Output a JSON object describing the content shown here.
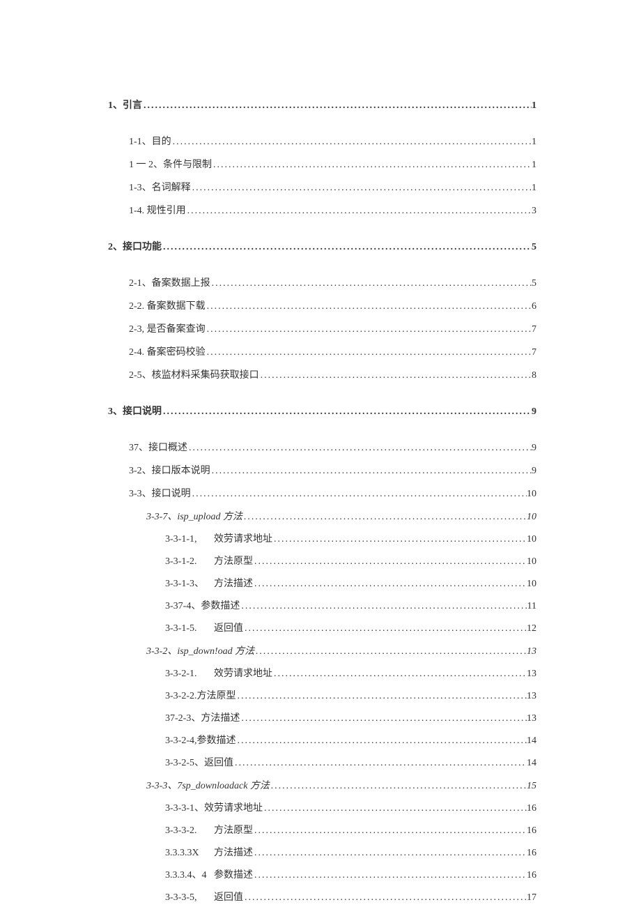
{
  "toc": [
    {
      "label": "1、引言",
      "page": "1",
      "indent": 0,
      "bold": true,
      "italic": false,
      "gap": "first",
      "split": false
    },
    {
      "label": "1-1、目的",
      "page": "1",
      "indent": 1,
      "bold": false,
      "italic": false,
      "gap": "top",
      "split": false
    },
    {
      "label": "1 一 2、条件与限制",
      "page": "1",
      "indent": 1,
      "bold": false,
      "italic": false,
      "gap": "line",
      "split": false
    },
    {
      "label": "1-3、名词解释",
      "page": "1",
      "indent": 1,
      "bold": false,
      "italic": false,
      "gap": "line",
      "split": false
    },
    {
      "label": "1-4. 规性引用",
      "page": "3",
      "indent": 1,
      "bold": false,
      "italic": false,
      "gap": "line",
      "split": false
    },
    {
      "label": "2、接口功能",
      "page": "5",
      "indent": 0,
      "bold": true,
      "italic": false,
      "gap": "top",
      "split": false
    },
    {
      "label": "2-1、备案数据上报",
      "page": "5",
      "indent": 1,
      "bold": false,
      "italic": false,
      "gap": "top",
      "split": false
    },
    {
      "label": "2-2. 备案数据下载",
      "page": "6",
      "indent": 1,
      "bold": false,
      "italic": false,
      "gap": "line",
      "split": false
    },
    {
      "label": "2-3, 是否备案查询",
      "page": "7",
      "indent": 1,
      "bold": false,
      "italic": false,
      "gap": "line",
      "split": false
    },
    {
      "label": "2-4. 备案密码校验",
      "page": "7",
      "indent": 1,
      "bold": false,
      "italic": false,
      "gap": "line",
      "split": false
    },
    {
      "label": "2-5、核监材料采集码获取接口",
      "page": "8",
      "indent": 1,
      "bold": false,
      "italic": false,
      "gap": "line",
      "split": false
    },
    {
      "label": "3、接口说明",
      "page": "9",
      "indent": 0,
      "bold": true,
      "italic": false,
      "gap": "top",
      "split": false
    },
    {
      "label": "37、接口概述",
      "page": "9",
      "indent": 1,
      "bold": false,
      "italic": false,
      "gap": "top",
      "split": false
    },
    {
      "label": "3-2、接口版本说明",
      "page": "9",
      "indent": 1,
      "bold": false,
      "italic": false,
      "gap": "line",
      "split": false
    },
    {
      "label": "3-3、接口说明",
      "page": "10",
      "indent": 1,
      "bold": false,
      "italic": false,
      "gap": "line",
      "split": false
    },
    {
      "label": "3-3-7、isp_upload 方法",
      "page": "10",
      "indent": 2,
      "bold": false,
      "italic": true,
      "gap": "line",
      "split": false
    },
    {
      "num": "3-3-1-1,",
      "text": "效劳请求地址",
      "page": "10",
      "indent": 3,
      "bold": false,
      "italic": false,
      "gap": "tight",
      "split": true
    },
    {
      "num": "3-3-1-2.",
      "text": "方法原型",
      "page": "10",
      "indent": 3,
      "bold": false,
      "italic": false,
      "gap": "tight",
      "split": true
    },
    {
      "num": "3-3-1-3、",
      "text": "方法描述",
      "page": "10",
      "indent": 3,
      "bold": false,
      "italic": false,
      "gap": "tight",
      "split": true
    },
    {
      "label": "3-37-4、参数描述",
      "page": "11",
      "indent": 3,
      "bold": false,
      "italic": false,
      "gap": "tight",
      "split": false
    },
    {
      "num": "3-3-1-5.",
      "text": "返回值",
      "page": "12",
      "indent": 3,
      "bold": false,
      "italic": false,
      "gap": "tight",
      "split": true
    },
    {
      "label": "3-3-2、isp_down!oad 方法",
      "page": "13",
      "indent": 2,
      "bold": false,
      "italic": true,
      "gap": "line",
      "split": false
    },
    {
      "num": "3-3-2-1.",
      "text": "效劳请求地址",
      "page": "13",
      "indent": 3,
      "bold": false,
      "italic": false,
      "gap": "tight",
      "split": true
    },
    {
      "label": "3-3-2-2.方法原型",
      "page": "13",
      "indent": 3,
      "bold": false,
      "italic": false,
      "gap": "tight",
      "split": false
    },
    {
      "label": "37-2-3、方法描述",
      "page": "13",
      "indent": 3,
      "bold": false,
      "italic": false,
      "gap": "tight",
      "split": false
    },
    {
      "label": "3-3-2-4,参数描述",
      "page": "14",
      "indent": 3,
      "bold": false,
      "italic": false,
      "gap": "tight",
      "split": false
    },
    {
      "label": "3-3-2-5、返回值",
      "page": "14",
      "indent": 3,
      "bold": false,
      "italic": false,
      "gap": "tight",
      "split": false
    },
    {
      "label": "3-3-3、7sp_downloadack 方法",
      "page": "15",
      "indent": 2,
      "bold": false,
      "italic": true,
      "gap": "line",
      "split": false
    },
    {
      "label": "3-3-3-1、效劳请求地址",
      "page": "16",
      "indent": 3,
      "bold": false,
      "italic": false,
      "gap": "tight",
      "split": false
    },
    {
      "num": "3-3-3-2.",
      "text": "方法原型",
      "page": "16",
      "indent": 3,
      "bold": false,
      "italic": false,
      "gap": "tight",
      "split": true
    },
    {
      "num": "3.3.3.3X",
      "text": "方法描述",
      "page": "16",
      "indent": 3,
      "bold": false,
      "italic": false,
      "gap": "tight",
      "split": true
    },
    {
      "num": "3.3.3.4、4",
      "text": "参数描述",
      "page": "16",
      "indent": 3,
      "bold": false,
      "italic": false,
      "gap": "tight",
      "split": true
    },
    {
      "num": "3-3-3-5,",
      "text": "返回值",
      "page": "17",
      "indent": 3,
      "bold": false,
      "italic": false,
      "gap": "tight",
      "split": true
    }
  ]
}
